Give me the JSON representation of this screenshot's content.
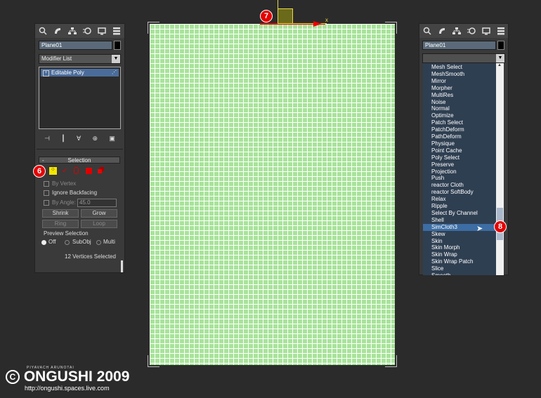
{
  "left_panel": {
    "object_name": "Plane01",
    "modifier_list": "Modifier List",
    "stack_item": "Editable Poly",
    "rollout_title": "Selection",
    "rollout_minus": "-",
    "by_vertex": "By Vertex",
    "ignore_backfacing": "Ignore Backfacing",
    "by_angle": "By Angle:",
    "angle_value": "45.0",
    "shrink": "Shrink",
    "grow": "Grow",
    "ring": "Ring",
    "loop": "Loop",
    "preview_selection": "Preview Selection",
    "preview_off": "Off",
    "preview_subobj": "SubObj",
    "preview_multi": "Multi",
    "status": "12 Vertices Selected"
  },
  "right_panel": {
    "object_name": "Plane01",
    "modifier_items": [
      "Mesh Select",
      "MeshSmooth",
      "Mirror",
      "Morpher",
      "MultiRes",
      "Noise",
      "Normal",
      "Optimize",
      "Patch Select",
      "PatchDeform",
      "PathDeform",
      "Physique",
      "Point Cache",
      "Poly Select",
      "Preserve",
      "Projection",
      "Push",
      "reactor Cloth",
      "reactor SoftBody",
      "Relax",
      "Ripple",
      "Select By Channel",
      "Shell",
      "SimCloth3",
      "Skew",
      "Skin",
      "Skin Morph",
      "Skin Wrap",
      "Skin Wrap Patch",
      "Slice",
      "Smooth"
    ],
    "selected_index": 23,
    "scroll_position": 0.8
  },
  "badges": {
    "six": "6",
    "seven": "7",
    "eight": "8"
  },
  "gizmo": {
    "axis": "x"
  },
  "watermark": {
    "author": "PIYAVACH ARUNOTAI",
    "brand": "ONGUSHI 2009",
    "url": "http://ongushi.spaces.live.com"
  },
  "icons": {
    "create": "create-icon",
    "modify": "modify-icon",
    "hierarchy": "hierarchy-icon",
    "motion": "motion-icon",
    "display": "display-icon",
    "utilities": "utilities-icon"
  },
  "colors": {
    "accent_red": "#e40000",
    "viewport_green": "#a8e39a",
    "selected_blue": "#3c6da3",
    "vertex_yellow": "#f5e600"
  }
}
